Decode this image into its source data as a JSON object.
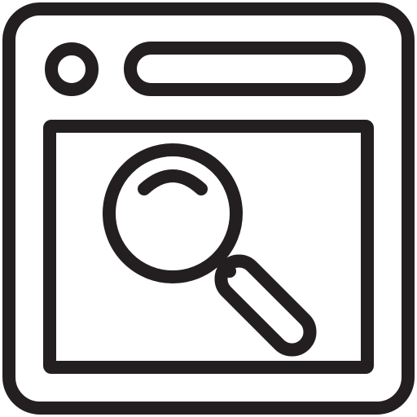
{
  "icon": {
    "name": "browser-window-search-icon",
    "stroke_color": "#231f20",
    "background_color": "#ffffff"
  }
}
